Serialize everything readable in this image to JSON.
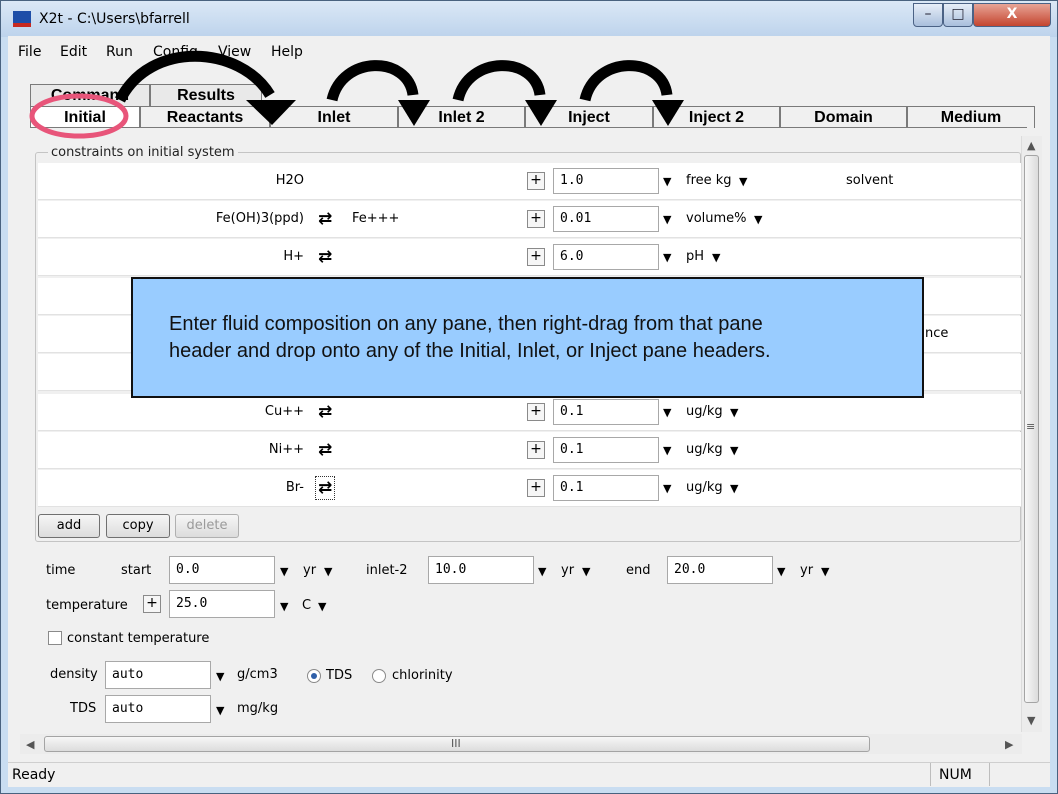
{
  "window": {
    "title": "X2t - C:\\Users\\bfarrell",
    "minimize_glyph": "–",
    "maximize_glyph": "□",
    "close_glyph": "X"
  },
  "menu": {
    "items": [
      "File",
      "Edit",
      "Run",
      "Config",
      "View",
      "Help"
    ]
  },
  "tabs": {
    "back": [
      "Command",
      "Results"
    ],
    "front": [
      "Initial",
      "Reactants",
      "Inlet",
      "Inlet 2",
      "Inject",
      "Inject 2",
      "Domain",
      "Medium"
    ],
    "active": "Initial"
  },
  "group_label": "constraints on initial system",
  "icons": {
    "swap": "⇄",
    "plus": "+",
    "dropdown": "▼",
    "scroll_up": "▲",
    "scroll_down": "▼",
    "scroll_left": "◀",
    "scroll_right": "▶",
    "grip": "≡",
    "hgrip": "III"
  },
  "rows": [
    {
      "species": "H2O",
      "swap": false,
      "alt": "",
      "value": "1.0",
      "unit": "free kg",
      "note": "solvent"
    },
    {
      "species": "Fe(OH)3(ppd)",
      "swap": true,
      "alt": "Fe+++",
      "value": "0.01",
      "unit": "volume%",
      "note": ""
    },
    {
      "species": "H+",
      "swap": true,
      "alt": "",
      "value": "6.0",
      "unit": "pH",
      "note": ""
    },
    {
      "species": "Cu++",
      "swap": true,
      "alt": "",
      "value": "0.1",
      "unit": "ug/kg",
      "note": ""
    },
    {
      "species": "Ni++",
      "swap": true,
      "alt": "",
      "value": "0.1",
      "unit": "ug/kg",
      "note": ""
    },
    {
      "species": "Br-",
      "swap": true,
      "alt": "",
      "value": "0.1",
      "unit": "ug/kg",
      "note": ""
    }
  ],
  "hidden_note_fragment": "nce",
  "buttons": {
    "add": "add",
    "copy": "copy",
    "delete": "delete"
  },
  "time": {
    "label": "time",
    "start_label": "start",
    "start": "0.0",
    "start_unit": "yr",
    "inlet2_label": "inlet-2",
    "inlet2": "10.0",
    "inlet2_unit": "yr",
    "end_label": "end",
    "end": "20.0",
    "end_unit": "yr"
  },
  "temperature": {
    "label": "temperature",
    "value": "25.0",
    "unit": "C"
  },
  "constant_temperature": {
    "label": "constant temperature",
    "checked": false
  },
  "density": {
    "label": "density",
    "value": "auto",
    "unit": "g/cm3",
    "radio_tds": "TDS",
    "radio_chlorinity": "chlorinity",
    "selected": "TDS"
  },
  "tds": {
    "label": "TDS",
    "value": "auto",
    "unit": "mg/kg"
  },
  "status": {
    "text": "Ready",
    "num": "NUM"
  },
  "callout": {
    "line1": "Enter fluid composition on any pane, then right-drag from that pane",
    "line2": "header and drop onto any of the Initial, Inlet, or Inject pane headers."
  },
  "colors": {
    "callout_bg": "#99ccff",
    "highlight_circle": "#e8557a",
    "arrow": "#000000"
  }
}
